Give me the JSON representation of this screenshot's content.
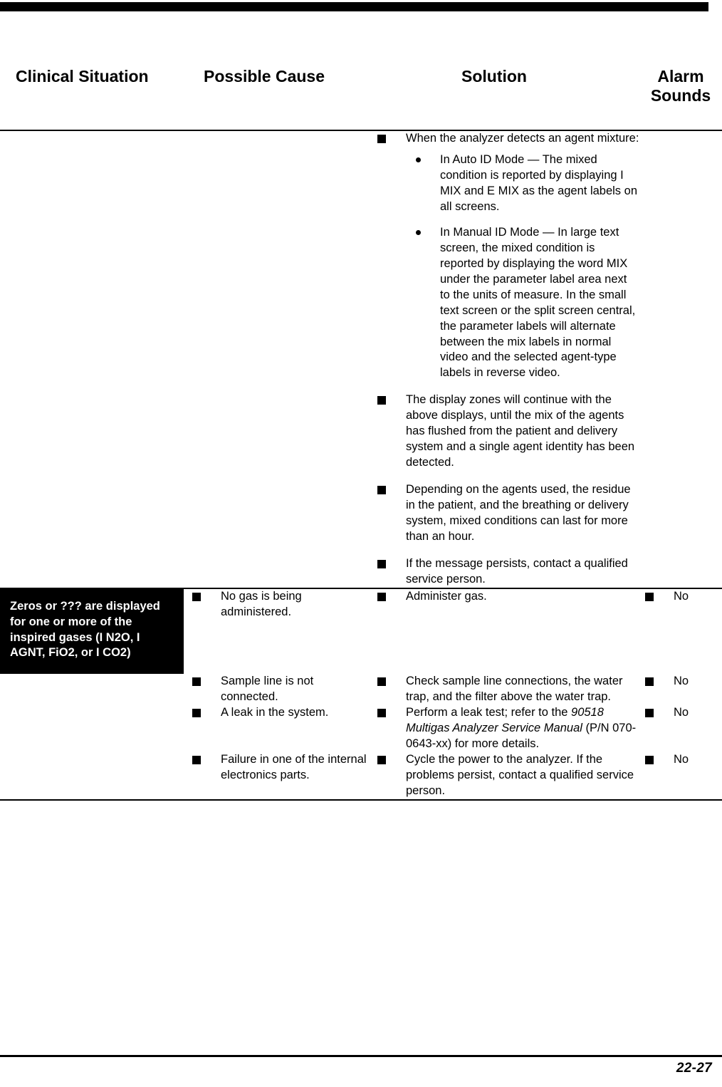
{
  "page": {
    "folio": "22-27"
  },
  "table": {
    "headers": {
      "clinical_situation": "Clinical Situation",
      "possible_cause": "Possible Cause",
      "solution": "Solution",
      "alarm_sounds_line1": "Alarm",
      "alarm_sounds_line2": "Sounds"
    },
    "rows": [
      {
        "clinical_situation": "",
        "possible_cause": [],
        "solution": [
          {
            "text": "When the analyzer detects an agent mixture:",
            "subitems": [
              "In Auto ID Mode — The mixed condition is reported by displaying I MIX and E MIX as the agent labels on all screens.",
              "In Manual ID Mode — In large text screen, the mixed condition is reported by displaying the word MIX under the parameter label area next to the units of measure. In the small text screen or the split screen central, the parameter labels will alternate between the mix labels in normal video and the selected agent-type labels in reverse video."
            ]
          },
          {
            "text": "The display zones will continue with the above displays, until the mix of the agents has flushed from the patient and delivery system and a single agent identity has been detected."
          },
          {
            "text": "Depending on the agents used, the residue in the patient, and the breathing or delivery system, mixed conditions can last for more than an hour."
          },
          {
            "text": "If the message persists, contact a qualified service person."
          }
        ],
        "alarm_sounds": []
      },
      {
        "clinical_situation": "Zeros or ??? are displayed for one or more of the inspired gases (I N2O, I AGNT, FiO2, or I CO2)",
        "possible_cause": [
          {
            "text": "No gas is being administered."
          }
        ],
        "solution": [
          {
            "text": "Administer gas."
          }
        ],
        "alarm_sounds": [
          {
            "text": "No"
          }
        ]
      },
      {
        "clinical_situation": "",
        "possible_cause": [
          {
            "text": "Sample line is not connected."
          }
        ],
        "solution": [
          {
            "text": "Check sample line connections, the water trap, and the filter above the water trap."
          }
        ],
        "alarm_sounds": [
          {
            "text": "No"
          }
        ]
      },
      {
        "clinical_situation": "",
        "possible_cause": [
          {
            "text": "A leak in the system."
          }
        ],
        "solution": [
          {
            "prefix": "Perform a leak test; refer to the ",
            "italic": "90518 Multigas Analyzer Service Manual",
            "suffix": " (P/N 070-0643-xx) for more details."
          }
        ],
        "alarm_sounds": [
          {
            "text": "No"
          }
        ]
      },
      {
        "clinical_situation": "",
        "possible_cause": [
          {
            "text": "Failure in one of the internal electronics parts."
          }
        ],
        "solution": [
          {
            "text": "Cycle the power to the analyzer. If the problems persist, contact a qualified service person."
          }
        ],
        "alarm_sounds": [
          {
            "text": "No"
          }
        ]
      }
    ]
  }
}
